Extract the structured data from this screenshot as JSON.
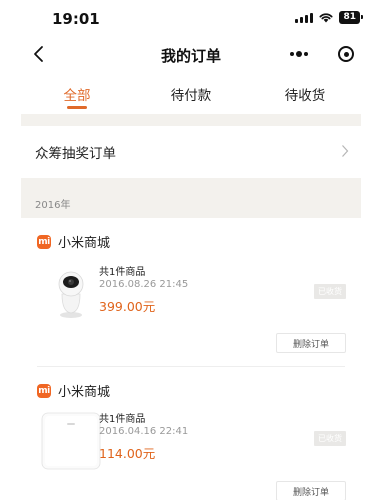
{
  "status_bar": {
    "time": "19:01",
    "battery": "81"
  },
  "nav": {
    "title": "我的订单"
  },
  "tabs": [
    {
      "label": "全部",
      "active": true
    },
    {
      "label": "待付款",
      "active": false
    },
    {
      "label": "待收货",
      "active": false
    }
  ],
  "crowdfunding": {
    "label": "众筹抽奖订单"
  },
  "year_label": "2016年",
  "orders": [
    {
      "shop": "小米商城",
      "logo_text": "mi",
      "count": "共1件商品",
      "time": "2016.08.26 21:45",
      "price": "399.00元",
      "status": "已收货",
      "delete_label": "删除订单",
      "thumb_icon": "security-camera-icon"
    },
    {
      "shop": "小米商城",
      "logo_text": "mi",
      "count": "共1件商品",
      "time": "2016.04.16 22:41",
      "price": "114.00元",
      "status": "已收货",
      "delete_label": "删除订单",
      "thumb_icon": "smart-scale-icon"
    }
  ],
  "colors": {
    "accent": "#e06a2a",
    "price": "#e0641c",
    "brand": "#f06623",
    "section_bg": "#f3f1ed"
  }
}
